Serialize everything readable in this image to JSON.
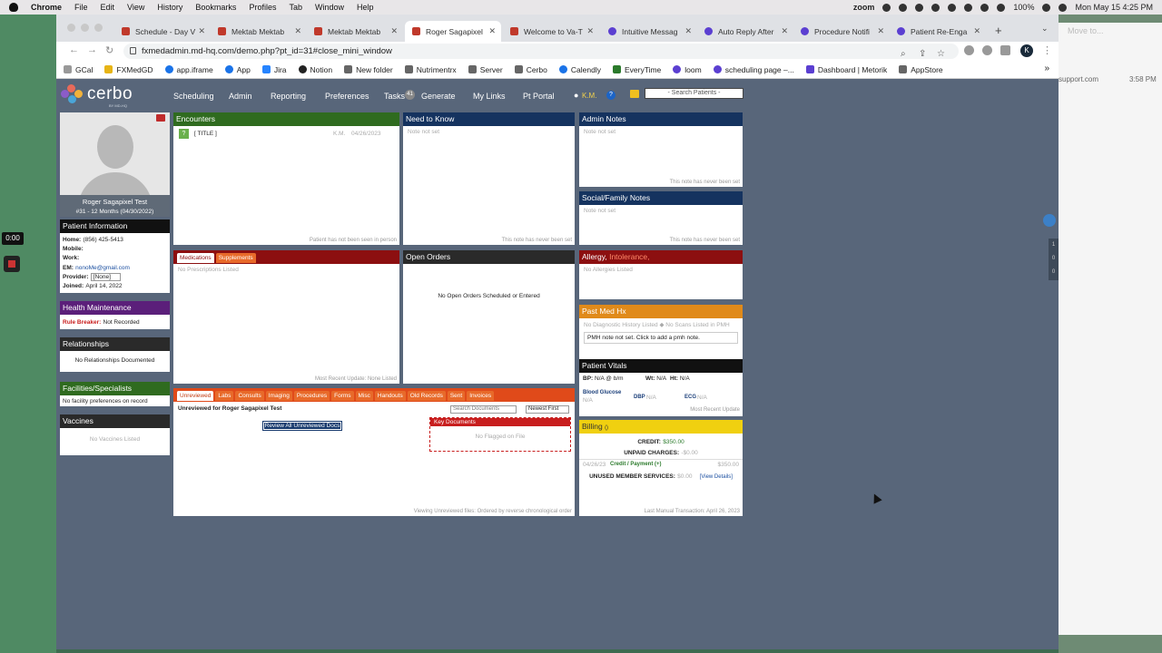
{
  "menubar": {
    "items": [
      "Chrome",
      "File",
      "Edit",
      "View",
      "History",
      "Bookmarks",
      "Profiles",
      "Tab",
      "Window",
      "Help"
    ],
    "zoom": "zoom",
    "battery": "100%",
    "datetime": "Mon May 15  4:25 PM"
  },
  "desktop": {
    "timer": "0:00",
    "bg_moveto": "Move to...",
    "bg_support": "support.com",
    "bg_time": "3:58 PM"
  },
  "tabs": [
    {
      "label": "Schedule - Day V",
      "color": "#c0392b"
    },
    {
      "label": "Mektab Mektab",
      "color": "#c0392b"
    },
    {
      "label": "Mektab Mektab",
      "color": "#c0392b"
    },
    {
      "label": "Roger Sagapixel",
      "color": "#c0392b"
    },
    {
      "label": "Welcome to Va-T",
      "color": "#c0392b"
    },
    {
      "label": "Intuitive Messag",
      "color": "#5b3fd1"
    },
    {
      "label": "Auto Reply After",
      "color": "#5b3fd1"
    },
    {
      "label": "Procedure Notifi",
      "color": "#5b3fd1"
    },
    {
      "label": "Patient Re-Enga",
      "color": "#5b3fd1"
    }
  ],
  "url": "fxmedadmin.md-hq.com/demo.php?pt_id=31#close_mini_window",
  "profile_initial": "K",
  "bookmarks": [
    {
      "label": "GCal",
      "color": "#999"
    },
    {
      "label": "FXMedGD",
      "color": "#e7b416"
    },
    {
      "label": "app.iframe",
      "color": "#1a73e8"
    },
    {
      "label": "App",
      "color": "#1a73e8"
    },
    {
      "label": "Jira",
      "color": "#2684ff"
    },
    {
      "label": "Notion",
      "color": "#222"
    },
    {
      "label": "New folder",
      "color": "#666"
    },
    {
      "label": "Nutrimentrx",
      "color": "#666"
    },
    {
      "label": "Server",
      "color": "#666"
    },
    {
      "label": "Cerbo",
      "color": "#666"
    },
    {
      "label": "Calendly",
      "color": "#1a73e8"
    },
    {
      "label": "EveryTime",
      "color": "#2b7a2b"
    },
    {
      "label": "loom",
      "color": "#5b3fd1"
    },
    {
      "label": "scheduling page –...",
      "color": "#5b3fd1"
    },
    {
      "label": "Dashboard | Metorik",
      "color": "#5b3fd1"
    },
    {
      "label": "AppStore",
      "color": "#666"
    }
  ],
  "app": {
    "logo": "cerbo",
    "logo_sub": "BY MD-HQ",
    "nav": [
      "Scheduling",
      "Admin",
      "Reporting",
      "Preferences",
      "Tasks",
      "Generate",
      "My Links",
      "Pt Portal"
    ],
    "tasks_count": "41",
    "user": "K.M.",
    "search_placeholder": "- Search Patients -"
  },
  "patient": {
    "name": "Roger Sagapixel Test",
    "meta": "#31 - 12 Months (04/30/2022)",
    "info_title": "Patient Information",
    "home_label": "Home:",
    "home": "(856) 425-5413",
    "mobile_label": "Mobile:",
    "work_label": "Work:",
    "email_label": "EM:",
    "email": "nonoMe@gmail.com",
    "provider_label": "Provider:",
    "provider": "[None]",
    "joined_label": "Joined:",
    "joined": "April 14, 2022"
  },
  "health": {
    "title": "Health Maintenance",
    "rule_label": "Rule Breaker:",
    "rule_value": "Not Recorded"
  },
  "relationships": {
    "title": "Relationships",
    "empty": "No Relationships Documented"
  },
  "facilities": {
    "title": "Facilities/Specialists",
    "empty": "No facility preferences on record"
  },
  "vaccines": {
    "title": "Vaccines",
    "empty": "No Vaccines Listed"
  },
  "encounters": {
    "title": "Encounters",
    "row": {
      "label": "[ TITLE ]",
      "user": "K.M.",
      "date": "04/26/2023"
    },
    "foot": "Patient has not been seen in person"
  },
  "need_to_know": {
    "title": "Need to Know",
    "empty": "Note not set",
    "foot": "This note has never been set"
  },
  "admin_notes": {
    "title": "Admin Notes",
    "empty": "Note not set",
    "foot": "This note has never been set"
  },
  "social": {
    "title": "Social/Family Notes",
    "empty": "Note not set",
    "foot": "This note has never been set"
  },
  "medications": {
    "tabs": [
      "Medications",
      "Supplements"
    ],
    "empty": "No Prescriptions Listed",
    "foot": "Most Recent Update: None Listed"
  },
  "orders": {
    "title": "Open Orders",
    "empty": "No Open Orders Scheduled or Entered"
  },
  "allergy": {
    "title": "Allergy,",
    "intol": "Intolerance,",
    "empty": "No Allergies Listed"
  },
  "pmh": {
    "title": "Past Med Hx",
    "line1": "No Diagnostic History Listed",
    "line2": "No Scans Listed in PMH",
    "note": "PMH note not set. Click to add a pmh note."
  },
  "vitals": {
    "title": "Patient Vitals",
    "bp_label": "BP:",
    "bp": "N/A @ b/m",
    "wt_label": "Wt:",
    "wt": "N/A",
    "ht_label": "Ht:",
    "ht": "N/A",
    "glucose_label": "Blood Glucose",
    "glucose": "N/A",
    "dbp_label": "DBP",
    "dbp": "N/A",
    "ecg_label": "ECG",
    "ecg": "N/A",
    "foot": "Most Recent Update"
  },
  "billing": {
    "title": "Billing",
    "count": "()",
    "credit_label": "CREDIT:",
    "credit": "$350.00",
    "unpaid_label": "UNPAID CHARGES:",
    "unpaid": "-$0.00",
    "txn_date": "04/26/23",
    "txn_label": "Credit / Payment (+)",
    "txn_amount": "$350.00",
    "unused_label": "UNUSED MEMBER SERVICES:",
    "unused": "$0.00",
    "details": "[View Details]",
    "foot": "Last Manual Transaction: April 26, 2023"
  },
  "docs": {
    "tabs": [
      "Unreviewed",
      "Labs",
      "Consults",
      "Imaging",
      "Procedures",
      "Forms",
      "Misc",
      "Handouts",
      "Old Records",
      "Sent",
      "Invoices"
    ],
    "unreviewed_for": "Unreviewed for Roger Sagapixel Test",
    "search_placeholder": "Search Documents",
    "sort": "Newest First",
    "review_btn": "Review All Unreviewed Docs",
    "key_title": "Key Documents",
    "key_empty": "No Flagged on File",
    "foot": "Viewing Unreviewed files: Ordered by reverse chronological order"
  },
  "right_rail": [
    "1",
    "0",
    "0"
  ]
}
